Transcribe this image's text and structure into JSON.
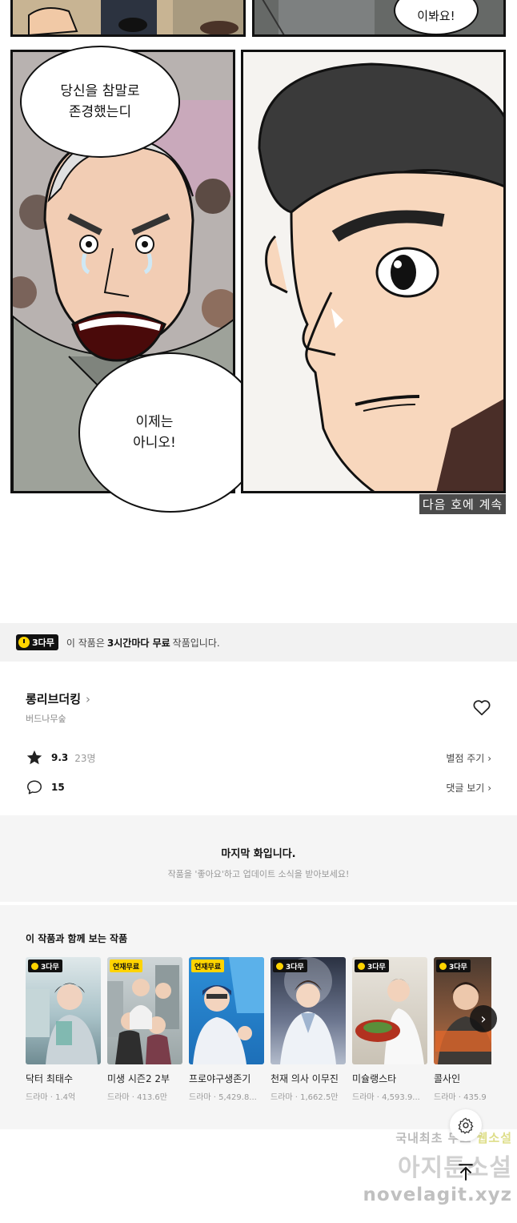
{
  "comic": {
    "bubble_top": "이봐요!",
    "bubble_left_top": "당신을 참말로\n존경했는디",
    "bubble_left_bottom": "이제는\n아니오!",
    "caption": "다음 호에 계속"
  },
  "notice": {
    "badge": "3다무",
    "text_before": "이 작품은",
    "text_bold": "3시간마다 무료",
    "text_after": "작품입니다."
  },
  "work": {
    "title": "롱리브더킹",
    "author": "버드나무숲",
    "rating": "9.3",
    "rating_count": "23명",
    "rate_link": "별점 주기",
    "comment_count": "15",
    "comment_link": "댓글 보기"
  },
  "last_episode": {
    "title": "마지막 화입니다.",
    "subtitle": "작품을 '좋아요'하고 업데이트 소식을 받아보세요!"
  },
  "recommendations": {
    "heading": "이 작품과 함께 보는 작품",
    "items": [
      {
        "title": "닥터 최태수",
        "meta": "드라마 · 1.4억",
        "tag": "3다무"
      },
      {
        "title": "미생 시즌2 2부",
        "meta": "드라마 · 413.6만",
        "tag": "연재무료"
      },
      {
        "title": "프로야구생존기",
        "meta": "드라마 · 5,429.8...",
        "tag": "연재무료"
      },
      {
        "title": "천재 의사 이무진",
        "meta": "드라마 · 1,662.5만",
        "tag": "3다무"
      },
      {
        "title": "미슐랭스타",
        "meta": "드라마 · 4,593.9...",
        "tag": "3다무"
      },
      {
        "title": "콜사인",
        "meta": "드라마 · 435.9",
        "tag": "3다무"
      }
    ]
  },
  "watermark": {
    "line1_a": "국내최초 무료",
    "line1_b": "웹소설",
    "line2": "아지툰소설",
    "line3": "novelagit.xyz"
  },
  "colors": {
    "accent_yellow": "#ffd400",
    "badge_black": "#111111",
    "section_gray": "#f5f5f5"
  }
}
